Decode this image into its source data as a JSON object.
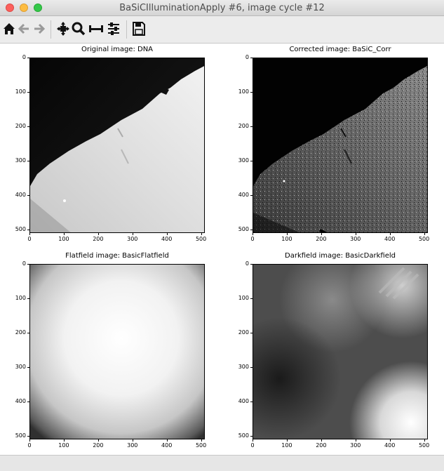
{
  "window": {
    "title": "BaSiCIlluminationApply #6, image cycle #12",
    "controls": [
      "close",
      "minimize",
      "zoom"
    ]
  },
  "toolbar": {
    "buttons": [
      {
        "icon": "home-icon",
        "label": "Home"
      },
      {
        "icon": "back-arrow-icon",
        "label": "Back"
      },
      {
        "icon": "forward-arrow-icon",
        "label": "Forward"
      },
      {
        "icon": "pan-icon",
        "label": "Pan"
      },
      {
        "icon": "zoom-icon",
        "label": "Zoom"
      },
      {
        "icon": "subplot-adjust-icon",
        "label": "Subplots"
      },
      {
        "icon": "configure-icon",
        "label": "Customize"
      },
      {
        "icon": "save-icon",
        "label": "Save"
      }
    ]
  },
  "panels": [
    {
      "title": "Original image: DNA",
      "image": "original"
    },
    {
      "title": "Corrected image: BaSiC_Corr",
      "image": "corrected"
    },
    {
      "title": "Flatfield image: BasicFlatfield",
      "image": "flatfield"
    },
    {
      "title": "Darkfield image: BasicDarkfield",
      "image": "darkfield"
    }
  ],
  "axes": {
    "x_ticks": [
      "0",
      "100",
      "200",
      "300",
      "400",
      "500"
    ],
    "y_ticks": [
      "0",
      "100",
      "200",
      "300",
      "400",
      "500"
    ],
    "range": [
      0,
      511
    ]
  }
}
